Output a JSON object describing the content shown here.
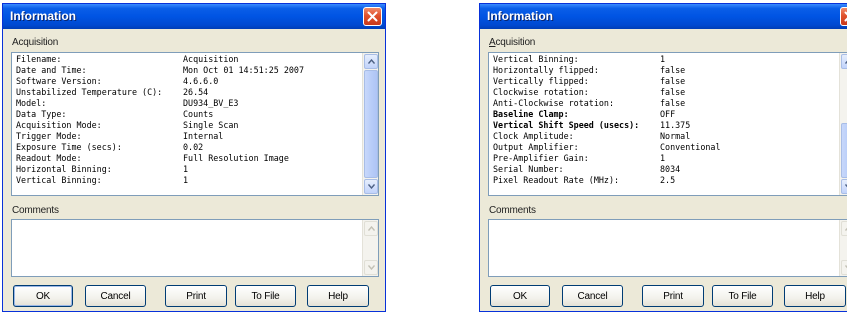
{
  "dialogs": [
    {
      "title": "Information",
      "acquisition_label": "Acquisition",
      "comments_label": "Comments",
      "comments_value": "",
      "rows": [
        {
          "key": "Filename:",
          "value": "Acquisition"
        },
        {
          "key": "Date and Time:",
          "value": "Mon Oct 01 14:51:25 2007"
        },
        {
          "key": "Software Version:",
          "value": "4.6.6.0"
        },
        {
          "key": "Unstabilized Temperature (C):",
          "value": "26.54"
        },
        {
          "key": "Model:",
          "value": "DU934_BV_E3"
        },
        {
          "key": "Data Type:",
          "value": "Counts"
        },
        {
          "key": "Acquisition Mode:",
          "value": "Single Scan"
        },
        {
          "key": "Trigger Mode:",
          "value": "Internal"
        },
        {
          "key": "Exposure Time (secs):",
          "value": "0.02"
        },
        {
          "key": "Readout Mode:",
          "value": "Full Resolution Image"
        },
        {
          "key": "Horizontal Binning:",
          "value": "1"
        },
        {
          "key": "Vertical Binning:",
          "value": "1"
        }
      ],
      "buttons": {
        "ok": "OK",
        "cancel": "Cancel",
        "print": "Print",
        "to_file": "To File",
        "help": "Help"
      }
    },
    {
      "title": "Information",
      "acquisition_label": "Acquisition",
      "comments_label": "Comments",
      "comments_value": "",
      "rows": [
        {
          "key": "Vertical Binning:",
          "value": "1"
        },
        {
          "key": "Horizontally flipped:",
          "value": "false"
        },
        {
          "key": "Vertically flipped:",
          "value": "false"
        },
        {
          "key": "Clockwise rotation:",
          "value": "false"
        },
        {
          "key": "Anti-Clockwise rotation:",
          "value": "false"
        },
        {
          "key": "Baseline Clamp:",
          "value": "OFF"
        },
        {
          "key": "Vertical Shift Speed (usecs):",
          "value": "11.375"
        },
        {
          "key": "Clock Amplitude:",
          "value": "Normal"
        },
        {
          "key": "Output Amplifier:",
          "value": "Conventional"
        },
        {
          "key": "Pre-Amplifier Gain:",
          "value": "1"
        },
        {
          "key": "Serial Number:",
          "value": "8034"
        },
        {
          "key": "Pixel Readout Rate (MHz):",
          "value": "2.5"
        }
      ],
      "buttons": {
        "ok": "OK",
        "cancel": "Cancel",
        "print": "Print",
        "to_file": "To File",
        "help": "Help"
      }
    }
  ],
  "icons": {
    "close": "close-icon",
    "scroll_up": "chevron-up-icon",
    "scroll_down": "chevron-down-icon"
  },
  "colors": {
    "titlebar": "#0054e3",
    "close_button": "#e0512c",
    "dialog_face": "#ece9d8",
    "field_border": "#7f9db9"
  }
}
